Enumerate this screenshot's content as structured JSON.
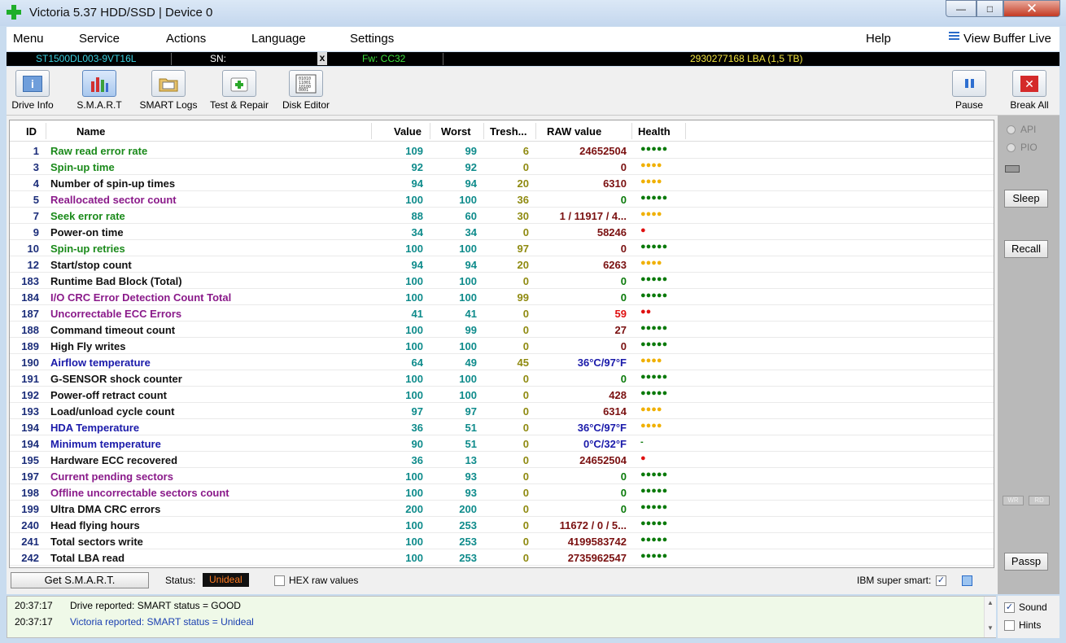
{
  "window": {
    "title": "Victoria 5.37 HDD/SSD | Device 0",
    "min_glyph": "—",
    "max_glyph": "□",
    "close_glyph": "✕"
  },
  "menu": {
    "items": [
      "Menu",
      "Service",
      "Actions",
      "Language",
      "Settings"
    ],
    "help": "Help",
    "view_buffer": "View Buffer Live"
  },
  "device": {
    "model": "ST1500DL003-9VT16L",
    "sn_label": "SN:",
    "sn_close": "x",
    "fw": "Fw: CC32",
    "lba": "2930277168 LBA (1,5 TB)"
  },
  "toolbar": {
    "drive_info": "Drive Info",
    "smart": "S.M.A.R.T",
    "smart_logs": "SMART Logs",
    "test_repair": "Test & Repair",
    "disk_editor": "Disk Editor",
    "pause": "Pause",
    "break_all": "Break All"
  },
  "table": {
    "headers": {
      "id": "ID",
      "name": "Name",
      "value": "Value",
      "worst": "Worst",
      "tresh": "Tresh...",
      "raw": "RAW value",
      "health": "Health"
    },
    "rows": [
      {
        "id": "1",
        "name": "Raw read error rate",
        "value": "109",
        "worst": "99",
        "tresh": "6",
        "raw": "24652504",
        "health": "●●●●●",
        "name_color": "#1a8a1a",
        "raw_color": "#7a1010",
        "health_color": "#0a7a0a"
      },
      {
        "id": "3",
        "name": "Spin-up time",
        "value": "92",
        "worst": "92",
        "tresh": "0",
        "raw": "0",
        "health": "●●●●",
        "name_color": "#1a8a1a",
        "raw_color": "#7a1010",
        "health_color": "#f0b000"
      },
      {
        "id": "4",
        "name": "Number of spin-up times",
        "value": "94",
        "worst": "94",
        "tresh": "20",
        "raw": "6310",
        "health": "●●●●",
        "name_color": "#111111",
        "raw_color": "#7a1010",
        "health_color": "#f0b000"
      },
      {
        "id": "5",
        "name": "Reallocated sector count",
        "value": "100",
        "worst": "100",
        "tresh": "36",
        "raw": "0",
        "health": "●●●●●",
        "name_color": "#8a1a8a",
        "raw_color": "#0a7a0a",
        "health_color": "#0a7a0a"
      },
      {
        "id": "7",
        "name": "Seek error rate",
        "value": "88",
        "worst": "60",
        "tresh": "30",
        "raw": "1 / 11917 / 4...",
        "health": "●●●●",
        "name_color": "#1a8a1a",
        "raw_color": "#7a1010",
        "health_color": "#f0b000"
      },
      {
        "id": "9",
        "name": "Power-on time",
        "value": "34",
        "worst": "34",
        "tresh": "0",
        "raw": "58246",
        "health": "●",
        "name_color": "#111111",
        "raw_color": "#7a1010",
        "health_color": "#e01010"
      },
      {
        "id": "10",
        "name": "Spin-up retries",
        "value": "100",
        "worst": "100",
        "tresh": "97",
        "raw": "0",
        "health": "●●●●●",
        "name_color": "#1a8a1a",
        "raw_color": "#7a1010",
        "health_color": "#0a7a0a"
      },
      {
        "id": "12",
        "name": "Start/stop count",
        "value": "94",
        "worst": "94",
        "tresh": "20",
        "raw": "6263",
        "health": "●●●●",
        "name_color": "#111111",
        "raw_color": "#7a1010",
        "health_color": "#f0b000"
      },
      {
        "id": "183",
        "name": "Runtime Bad Block (Total)",
        "value": "100",
        "worst": "100",
        "tresh": "0",
        "raw": "0",
        "health": "●●●●●",
        "name_color": "#111111",
        "raw_color": "#0a7a0a",
        "health_color": "#0a7a0a"
      },
      {
        "id": "184",
        "name": "I/O CRC Error Detection Count Total",
        "value": "100",
        "worst": "100",
        "tresh": "99",
        "raw": "0",
        "health": "●●●●●",
        "name_color": "#8a1a8a",
        "raw_color": "#0a7a0a",
        "health_color": "#0a7a0a"
      },
      {
        "id": "187",
        "name": "Uncorrectable ECC Errors",
        "value": "41",
        "worst": "41",
        "tresh": "0",
        "raw": "59",
        "health": "●●",
        "name_color": "#8a1a8a",
        "raw_color": "#e01010",
        "health_color": "#e01010"
      },
      {
        "id": "188",
        "name": "Command timeout count",
        "value": "100",
        "worst": "99",
        "tresh": "0",
        "raw": "27",
        "health": "●●●●●",
        "name_color": "#111111",
        "raw_color": "#7a1010",
        "health_color": "#0a7a0a"
      },
      {
        "id": "189",
        "name": "High Fly writes",
        "value": "100",
        "worst": "100",
        "tresh": "0",
        "raw": "0",
        "health": "●●●●●",
        "name_color": "#111111",
        "raw_color": "#7a1010",
        "health_color": "#0a7a0a"
      },
      {
        "id": "190",
        "name": "Airflow temperature",
        "value": "64",
        "worst": "49",
        "tresh": "45",
        "raw": "36°C/97°F",
        "health": "●●●●",
        "name_color": "#1a1aaa",
        "raw_color": "#1a1aaa",
        "health_color": "#f0b000"
      },
      {
        "id": "191",
        "name": "G-SENSOR shock counter",
        "value": "100",
        "worst": "100",
        "tresh": "0",
        "raw": "0",
        "health": "●●●●●",
        "name_color": "#111111",
        "raw_color": "#0a7a0a",
        "health_color": "#0a7a0a"
      },
      {
        "id": "192",
        "name": "Power-off retract count",
        "value": "100",
        "worst": "100",
        "tresh": "0",
        "raw": "428",
        "health": "●●●●●",
        "name_color": "#111111",
        "raw_color": "#7a1010",
        "health_color": "#0a7a0a"
      },
      {
        "id": "193",
        "name": "Load/unload cycle count",
        "value": "97",
        "worst": "97",
        "tresh": "0",
        "raw": "6314",
        "health": "●●●●",
        "name_color": "#111111",
        "raw_color": "#7a1010",
        "health_color": "#f0b000"
      },
      {
        "id": "194",
        "name": "HDA Temperature",
        "value": "36",
        "worst": "51",
        "tresh": "0",
        "raw": "36°C/97°F",
        "health": "●●●●",
        "name_color": "#1a1aaa",
        "raw_color": "#1a1aaa",
        "health_color": "#f0b000"
      },
      {
        "id": "194",
        "name": "Minimum temperature",
        "value": "90",
        "worst": "51",
        "tresh": "0",
        "raw": "0°C/32°F",
        "health": "-",
        "name_color": "#1a1aaa",
        "raw_color": "#1a1aaa",
        "health_color": "#0a7a0a"
      },
      {
        "id": "195",
        "name": "Hardware ECC recovered",
        "value": "36",
        "worst": "13",
        "tresh": "0",
        "raw": "24652504",
        "health": "●",
        "name_color": "#111111",
        "raw_color": "#7a1010",
        "health_color": "#e01010"
      },
      {
        "id": "197",
        "name": "Current pending sectors",
        "value": "100",
        "worst": "93",
        "tresh": "0",
        "raw": "0",
        "health": "●●●●●",
        "name_color": "#8a1a8a",
        "raw_color": "#0a7a0a",
        "health_color": "#0a7a0a"
      },
      {
        "id": "198",
        "name": "Offline uncorrectable sectors count",
        "value": "100",
        "worst": "93",
        "tresh": "0",
        "raw": "0",
        "health": "●●●●●",
        "name_color": "#8a1a8a",
        "raw_color": "#0a7a0a",
        "health_color": "#0a7a0a"
      },
      {
        "id": "199",
        "name": "Ultra DMA CRC errors",
        "value": "200",
        "worst": "200",
        "tresh": "0",
        "raw": "0",
        "health": "●●●●●",
        "name_color": "#111111",
        "raw_color": "#0a7a0a",
        "health_color": "#0a7a0a"
      },
      {
        "id": "240",
        "name": "Head flying hours",
        "value": "100",
        "worst": "253",
        "tresh": "0",
        "raw": "11672 / 0 / 5...",
        "health": "●●●●●",
        "name_color": "#111111",
        "raw_color": "#7a1010",
        "health_color": "#0a7a0a"
      },
      {
        "id": "241",
        "name": "Total sectors write",
        "value": "100",
        "worst": "253",
        "tresh": "0",
        "raw": "4199583742",
        "health": "●●●●●",
        "name_color": "#111111",
        "raw_color": "#7a1010",
        "health_color": "#0a7a0a"
      },
      {
        "id": "242",
        "name": "Total LBA read",
        "value": "100",
        "worst": "253",
        "tresh": "0",
        "raw": "2735962547",
        "health": "●●●●●",
        "name_color": "#111111",
        "raw_color": "#7a1010",
        "health_color": "#0a7a0a"
      }
    ]
  },
  "statusbar": {
    "get_smart": "Get S.M.A.R.T.",
    "status_label": "Status:",
    "status_value": "Unideal",
    "hex_label": "HEX raw values",
    "ibm_label": "IBM super smart:",
    "ibm_check": "✓"
  },
  "side": {
    "api": "API",
    "pio": "PIO",
    "sleep": "Sleep",
    "recall": "Recall",
    "wr": "WR",
    "rd": "RD",
    "passp": "Passp",
    "sound": "Sound",
    "sound_check": "✓",
    "hints": "Hints"
  },
  "log": [
    {
      "time": "20:37:17",
      "text": "Drive reported: SMART status = GOOD",
      "color": "#111111"
    },
    {
      "time": "20:37:17",
      "text": "Victoria reported: SMART status = Unideal",
      "color": "#1a3fb0"
    }
  ],
  "colors": {
    "value": "#0e8b8b",
    "tresh": "#8f8a10",
    "id": "#1b2d7a",
    "status_bg": "#111111",
    "status_fg": "#ff7a20"
  }
}
